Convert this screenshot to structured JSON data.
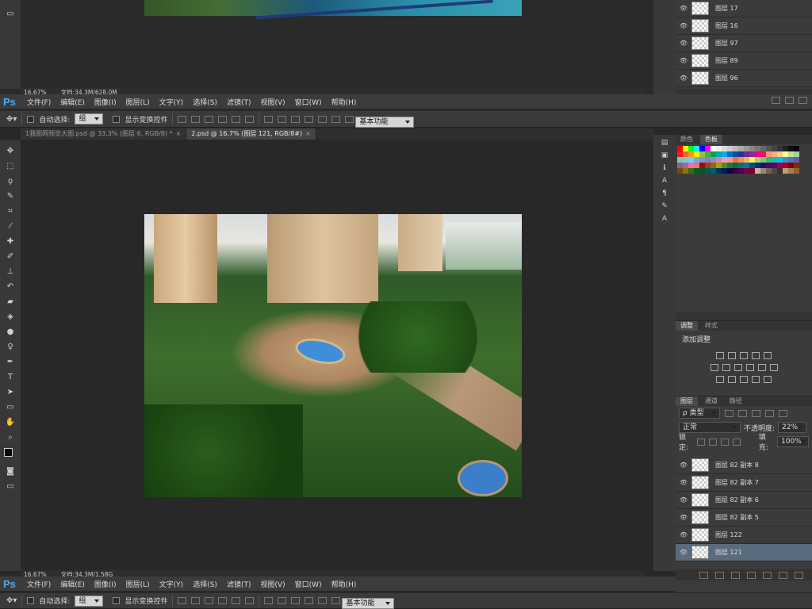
{
  "app_logo": "Ps",
  "menu": [
    "文件(F)",
    "编辑(E)",
    "图像(I)",
    "图层(L)",
    "文字(Y)",
    "选择(S)",
    "滤镜(T)",
    "视图(V)",
    "窗口(W)",
    "帮助(H)"
  ],
  "options": {
    "auto_select_label": "自动选择:",
    "auto_select_value": "组",
    "show_transform_label": "显示变换控件",
    "workspace": "基本功能"
  },
  "tabs": [
    {
      "label": "1我图网预览大图.psd @ 33.3% (图层 6, RGB/8) *",
      "close": "×"
    },
    {
      "label": "2.psd @ 16.7% (图层 121, RGB/8#)",
      "close": "×"
    }
  ],
  "status_top": {
    "zoom": "16.67%",
    "doc": "文档:34.3M/628.0M"
  },
  "status_main": {
    "zoom": "16.67%",
    "doc": "文档:34.3M/1.58G"
  },
  "top_layers": [
    "图层 17",
    "图层 16",
    "图层 97",
    "图层 89",
    "图层 96"
  ],
  "color_panel": {
    "tabs": [
      "颜色",
      "色板"
    ]
  },
  "swatches": [
    "#ff0000",
    "#ffff00",
    "#00ff00",
    "#00ffff",
    "#0000ff",
    "#ff00ff",
    "#ffffff",
    "#eeeeee",
    "#dddddd",
    "#cccccc",
    "#bbbbbb",
    "#aaaaaa",
    "#999999",
    "#888888",
    "#777777",
    "#666666",
    "#555555",
    "#444444",
    "#333333",
    "#222222",
    "#111111",
    "#000000",
    "#ed1c24",
    "#f26522",
    "#f7941d",
    "#fff200",
    "#8dc63f",
    "#39b54a",
    "#00a651",
    "#00a99d",
    "#00aeef",
    "#0072bc",
    "#0054a6",
    "#2e3192",
    "#662d91",
    "#92278f",
    "#ec008c",
    "#ed145b",
    "#f69679",
    "#f9ad81",
    "#fdc68a",
    "#fff799",
    "#c4df9b",
    "#a3d39c",
    "#82ca9c",
    "#7accc8",
    "#6dcff6",
    "#7da7d9",
    "#8393ca",
    "#8781bd",
    "#a186be",
    "#bd8cbf",
    "#f49ac1",
    "#f5989d",
    "#f26c4f",
    "#f68e56",
    "#fbaf5d",
    "#fff468",
    "#acd372",
    "#7cc576",
    "#3bb878",
    "#1abbb4",
    "#00bff3",
    "#438cca",
    "#5574b9",
    "#605ca8",
    "#855fa8",
    "#a863a8",
    "#f06eaa",
    "#f26d7d",
    "#9e0b0f",
    "#a0410d",
    "#a3620a",
    "#aba000",
    "#598527",
    "#1a7b30",
    "#007236",
    "#00746b",
    "#0076a3",
    "#004b80",
    "#003471",
    "#1b1464",
    "#440e62",
    "#630460",
    "#9e005d",
    "#9e0039",
    "#790000",
    "#7b2e00",
    "#7d4900",
    "#827b00",
    "#406618",
    "#005e20",
    "#005826",
    "#005952",
    "#005b7f",
    "#003663",
    "#002157",
    "#0d004c",
    "#32004b",
    "#4b0049",
    "#7b0046",
    "#7a0026",
    "#c7b299",
    "#998675",
    "#736357",
    "#534741",
    "#37302a",
    "#c69c6d",
    "#a67c52",
    "#8c6239"
  ],
  "adjust": {
    "tabs": [
      "调整",
      "样式"
    ],
    "title": "添加调整"
  },
  "layers_panel": {
    "tabs": [
      "图层",
      "通道",
      "路径"
    ],
    "filter": "ρ 类型",
    "blend": "正常",
    "opacity_label": "不透明度:",
    "opacity": "22%",
    "lock_label": "锁定:",
    "fill_label": "填充:",
    "fill": "100%",
    "layers": [
      "图层 82 副本 8",
      "图层 82 副本 7",
      "图层 82 副本 6",
      "图层 82 副本 5",
      "图层 122",
      "图层 121"
    ],
    "selected_index": 5
  }
}
